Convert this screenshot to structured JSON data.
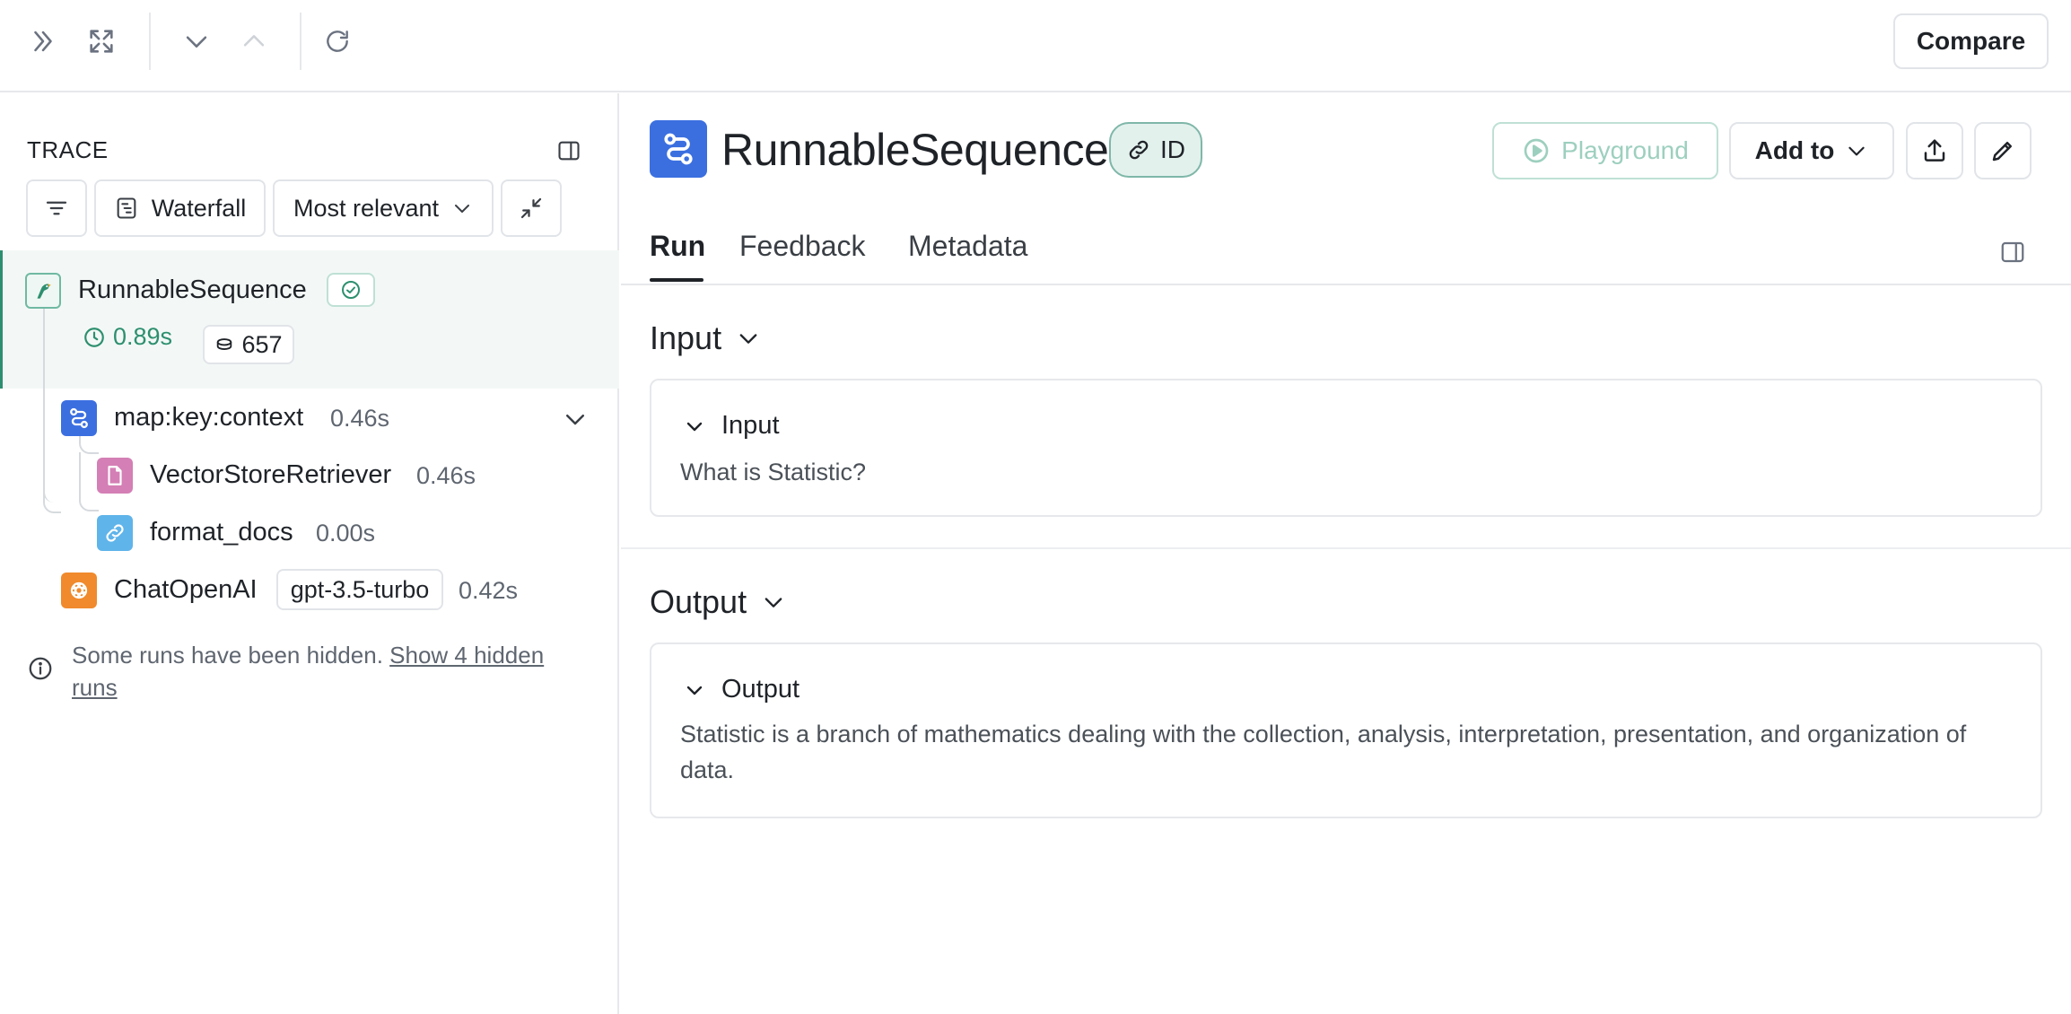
{
  "toolbar": {
    "compare_label": "Compare"
  },
  "trace_panel": {
    "title": "TRACE",
    "waterfall_label": "Waterfall",
    "sort_label": "Most relevant",
    "root": {
      "name": "RunnableSequence",
      "duration": "0.89s",
      "tokens": "657",
      "status": "success"
    },
    "children": [
      {
        "name": "map:key:context",
        "duration": "0.46s",
        "icon": "chain-icon",
        "color": "#3b6fe0"
      },
      {
        "name": "VectorStoreRetriever",
        "duration": "0.46s",
        "icon": "document-icon",
        "color": "#d47fb5"
      },
      {
        "name": "format_docs",
        "duration": "0.00s",
        "icon": "link-icon",
        "color": "#5fb4ea"
      },
      {
        "name": "ChatOpenAI",
        "model": "gpt-3.5-turbo",
        "duration": "0.42s",
        "icon": "openai-icon",
        "color": "#f08a2c"
      }
    ],
    "hidden_note": "Some runs have been hidden.",
    "hidden_link": "Show 4 hidden runs"
  },
  "run_panel": {
    "title": "RunnableSequence",
    "id_chip": "ID",
    "playground_label": "Playground",
    "add_to_label": "Add to",
    "tabs": [
      "Run",
      "Feedback",
      "Metadata"
    ],
    "active_tab": "Run",
    "input": {
      "section_title": "Input",
      "card_title": "Input",
      "value": "What is Statistic?"
    },
    "output": {
      "section_title": "Output",
      "card_title": "Output",
      "value": "Statistic is a branch of mathematics dealing with the collection, analysis, interpretation, presentation, and organization of data."
    }
  },
  "colors": {
    "accent_green": "#2d8f6f",
    "run_icon_blue": "#3b6fe0",
    "border": "#e1e4e8"
  }
}
